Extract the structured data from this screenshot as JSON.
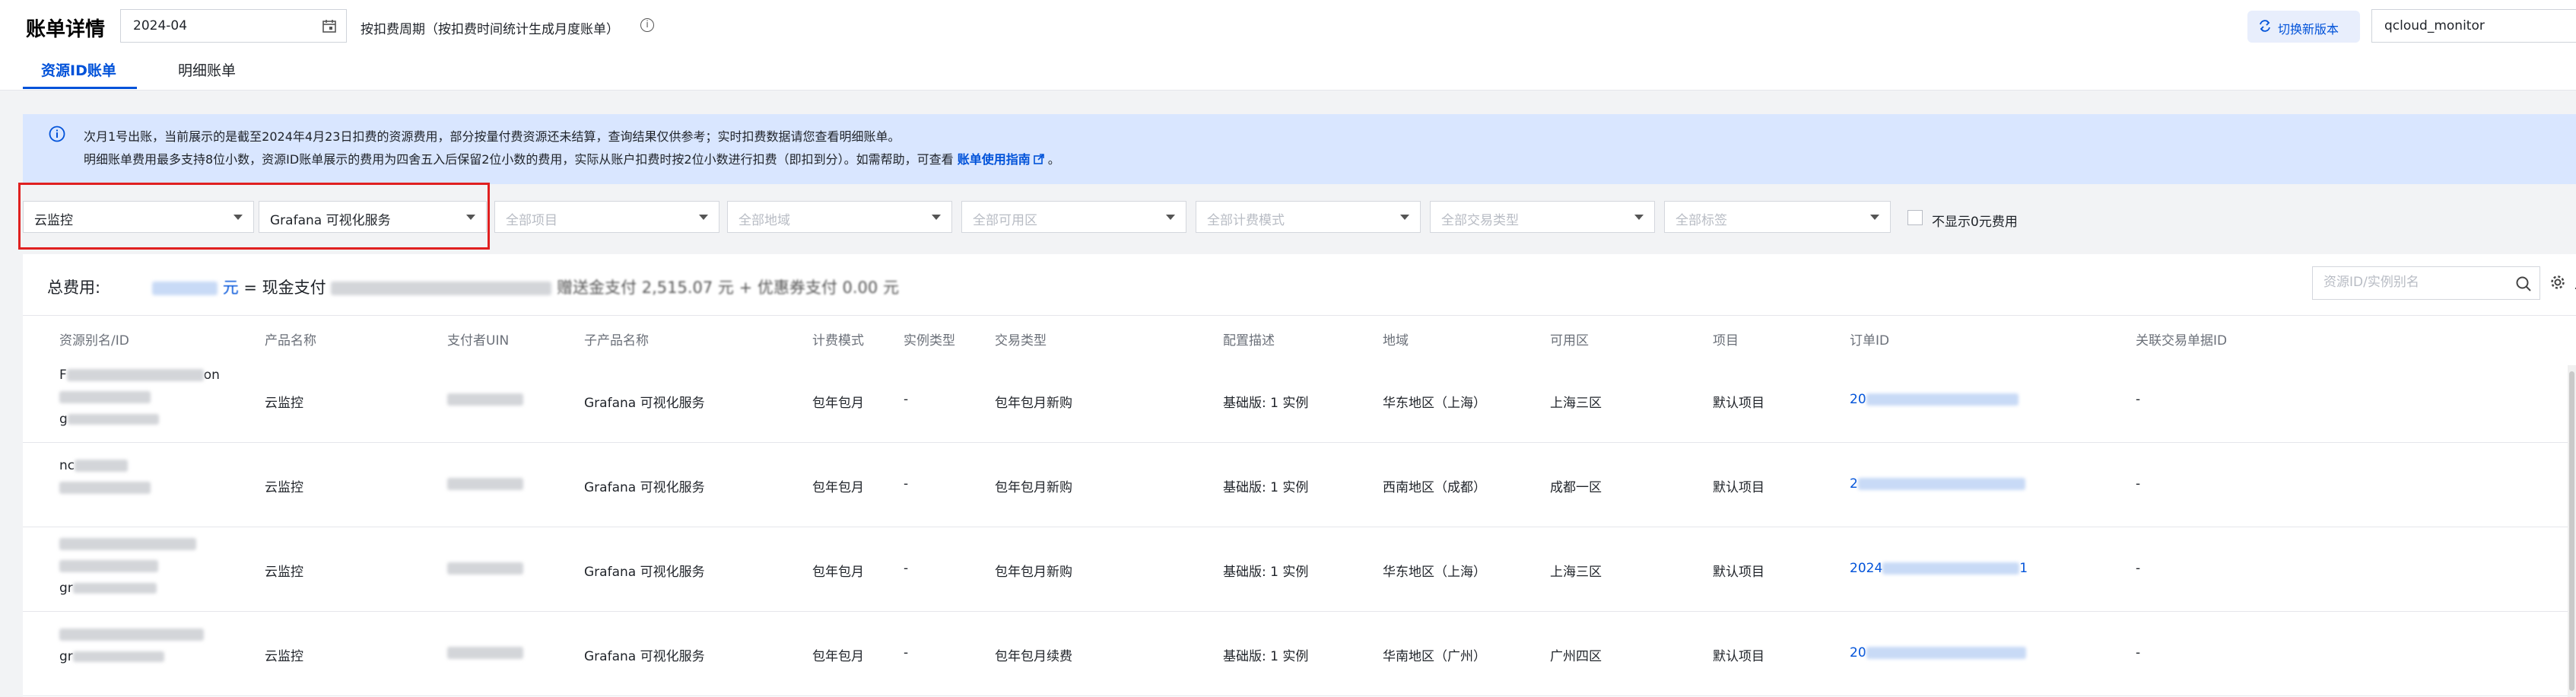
{
  "header": {
    "title": "账单详情",
    "month": "2024-04",
    "cycle_text": "按扣费周期（按扣费时间统计生成月度账单）",
    "switch_version": "切换新版本",
    "account": "qcloud_monitor"
  },
  "tabs": [
    {
      "label": "资源ID账单",
      "active": true
    },
    {
      "label": "明细账单",
      "active": false
    }
  ],
  "notice": {
    "line1": "次月1号出账，当前展示的是截至2024年4月23日扣费的资源费用，部分按量付费资源还未结算，查询结果仅供参考；实时扣费数据请您查看明细账单。",
    "line2": "明细账单费用最多支持8位小数，资源ID账单展示的费用为四舍五入后保留2位小数的费用，实际从账户扣费时按2位小数进行扣费（即扣到分）。如需帮助，可查看",
    "guide_link": "账单使用指南",
    "line2_end": "。"
  },
  "filters": [
    {
      "label": "云监控",
      "placeholder": false
    },
    {
      "label": "Grafana 可视化服务",
      "placeholder": false
    },
    {
      "label": "全部项目",
      "placeholder": true
    },
    {
      "label": "全部地域",
      "placeholder": true
    },
    {
      "label": "全部可用区",
      "placeholder": true
    },
    {
      "label": "全部计费模式",
      "placeholder": true
    },
    {
      "label": "全部交易类型",
      "placeholder": true
    },
    {
      "label": "全部标签",
      "placeholder": true
    }
  ],
  "hide_zero_label": "不显示0元费用",
  "summary": {
    "label": "总费用:",
    "yuan": "元",
    "cash_pay": "= 现金支付",
    "tail": "赠送金支付 2,515.07 元 + 优惠券支付 0.00 元"
  },
  "search_placeholder": "资源ID/实例别名",
  "table": {
    "headers": [
      "资源别名/ID",
      "产品名称",
      "支付者UIN",
      "子产品名称",
      "计费模式",
      "实例类型",
      "交易类型",
      "配置描述",
      "地域",
      "可用区",
      "项目",
      "订单ID",
      "关联交易单据ID"
    ],
    "rows": [
      {
        "alias": "F",
        "alias_tail": "on",
        "alias_sub": "g",
        "product": "云监控",
        "sub_product": "Grafana 可视化服务",
        "billing": "包年包月",
        "instance_type": "-",
        "trade_type": "包年包月新购",
        "config": "基础版: 1 实例",
        "region": "华东地区（上海）",
        "zone": "上海三区",
        "project": "默认项目",
        "order_prefix": "20",
        "order_suffix": "",
        "related": "-"
      },
      {
        "alias": "nc",
        "alias_tail": "",
        "alias_sub": "",
        "product": "云监控",
        "sub_product": "Grafana 可视化服务",
        "billing": "包年包月",
        "instance_type": "-",
        "trade_type": "包年包月新购",
        "config": "基础版: 1 实例",
        "region": "西南地区（成都）",
        "zone": "成都一区",
        "project": "默认项目",
        "order_prefix": "2",
        "order_suffix": "",
        "related": "-"
      },
      {
        "alias": "",
        "alias_tail": "",
        "alias_sub": "gr",
        "product": "云监控",
        "sub_product": "Grafana 可视化服务",
        "billing": "包年包月",
        "instance_type": "-",
        "trade_type": "包年包月新购",
        "config": "基础版: 1 实例",
        "region": "华东地区（上海）",
        "zone": "上海三区",
        "project": "默认项目",
        "order_prefix": "2024",
        "order_suffix": "1",
        "related": "-"
      },
      {
        "alias": "",
        "alias_tail": "",
        "alias_sub": "gr",
        "product": "云监控",
        "sub_product": "Grafana 可视化服务",
        "billing": "包年包月",
        "instance_type": "-",
        "trade_type": "包年包月续费",
        "config": "基础版: 1 实例",
        "region": "华南地区（广州）",
        "zone": "广州四区",
        "project": "默认项目",
        "order_prefix": "20",
        "order_suffix": "",
        "related": "-"
      }
    ]
  },
  "colors": {
    "accent": "#0052d9",
    "notice_bg": "#d9e6ff",
    "highlight": "#e02020"
  }
}
